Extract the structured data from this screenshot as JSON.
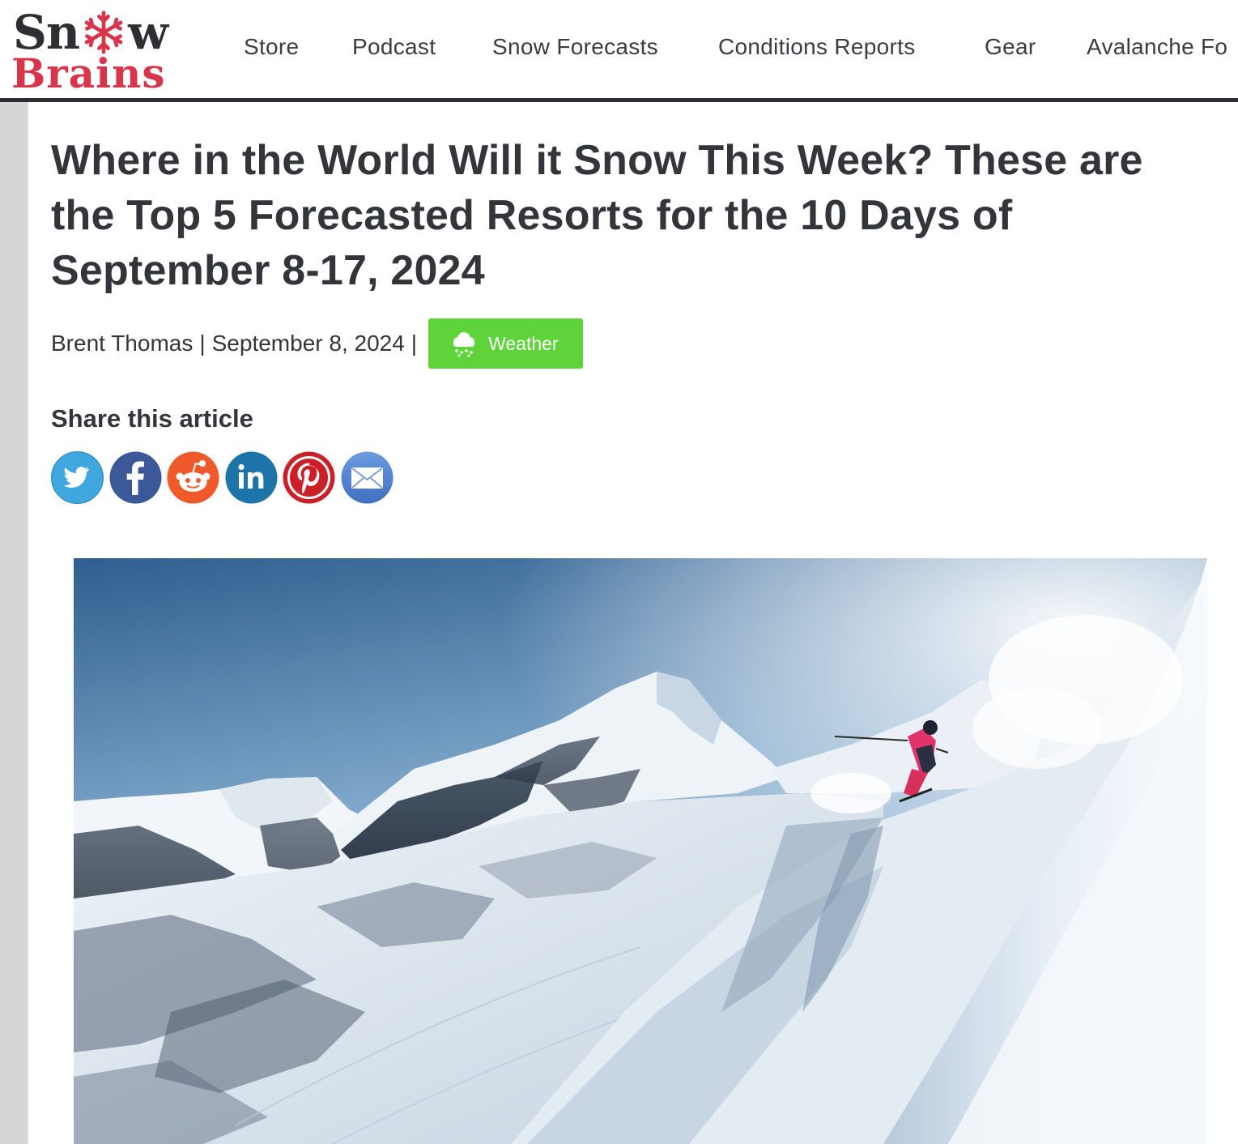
{
  "header": {
    "logo": {
      "line1_left": "Sn",
      "line1_right": "w",
      "line2": "Brains"
    },
    "nav": [
      {
        "label": "Store"
      },
      {
        "label": "Podcast"
      },
      {
        "label": "Snow Forecasts"
      },
      {
        "label": "Conditions Reports"
      },
      {
        "label": "Gear"
      },
      {
        "label": "Avalanche Fo"
      }
    ]
  },
  "article": {
    "title": "Where in the World Will it Snow This Week? These are the Top 5 Forecasted Resorts for the 10 Days of September 8-17, 2024",
    "author": "Brent Thomas",
    "separator": "|",
    "date": "September 8, 2024",
    "category": {
      "label": "Weather",
      "icon": "cloud-snow-icon",
      "color": "#5fd43a"
    }
  },
  "share": {
    "heading": "Share this article",
    "buttons": [
      {
        "network": "twitter",
        "icon": "twitter-icon",
        "color": "#3fa7de"
      },
      {
        "network": "facebook",
        "icon": "facebook-icon",
        "color": "#3b5998"
      },
      {
        "network": "reddit",
        "icon": "reddit-icon",
        "color": "#f05a2b"
      },
      {
        "network": "linkedin",
        "icon": "linkedin-icon",
        "color": "#1c74a8"
      },
      {
        "network": "pinterest",
        "icon": "pinterest-icon",
        "color": "#cb2027"
      },
      {
        "network": "email",
        "icon": "email-icon",
        "color": "#4f7fc9"
      }
    ]
  },
  "hero_image": {
    "subject": "skier-on-snowy-mountain-slope"
  },
  "colors": {
    "brand_red": "#d8344a",
    "text_dark": "#33353b",
    "header_rule": "#2c2e33",
    "gutter": "#d6d6d6"
  }
}
